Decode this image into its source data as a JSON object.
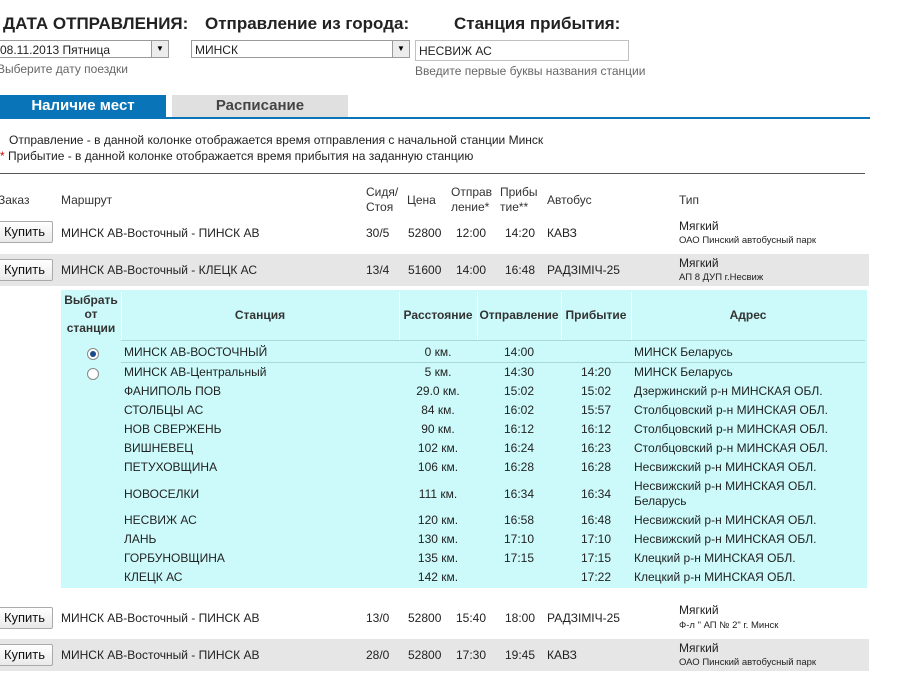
{
  "form": {
    "date_label": "ДАТА ОТПРАВЛЕНИЯ:",
    "date_value": "08.11.2013 Пятница",
    "date_hint": "Выберите дату поездки",
    "from_label": "Отправление из города:",
    "from_value": "МИНСК",
    "to_label": "Станция прибытия:",
    "to_value": "НЕСВИЖ АС",
    "to_hint": "Введите первые буквы названия станции"
  },
  "tabs": [
    {
      "label": "Наличие мест"
    },
    {
      "label": "Расписание"
    }
  ],
  "notes": {
    "line1": "Отправление - в данной колонке отображается время отправления с начальной станции Минск",
    "asterisk": "*",
    "line2": " Прибытие - в данной колонке отображается время прибытия на заданную станцию"
  },
  "table": {
    "headers": {
      "order": "Заказ",
      "route": "Маршрут",
      "seats_1": "Сидя/",
      "seats_2": "Стоя",
      "price": "Цена",
      "dep_1": "Отправ",
      "dep_2": "ление*",
      "arr_1": "Прибы",
      "arr_2": "тие**",
      "bus": "Автобус",
      "type": "Тип"
    },
    "buy_label": "Купить",
    "rows": [
      {
        "route": "МИНСК АВ-Восточный - ПИНСК АВ",
        "seats": "30/5",
        "price": "52800",
        "dep": "12:00",
        "arr": "14:20",
        "bus": "КАВЗ",
        "type": "Мягкий",
        "carrier": "ОАО Пинский автобусный парк"
      },
      {
        "route": "МИНСК АВ-Восточный - КЛЕЦК АС",
        "seats": "13/4",
        "price": "51600",
        "dep": "14:00",
        "arr": "16:48",
        "bus": "РАДЗІМІЧ-25",
        "type": "Мягкий",
        "carrier": "АП 8 ДУП г.Несвиж"
      },
      {
        "route": "МИНСК АВ-Восточный - ПИНСК АВ",
        "seats": "13/0",
        "price": "52800",
        "dep": "15:40",
        "arr": "18:00",
        "bus": "РАДЗІМІЧ-25",
        "type": "Мягкий",
        "carrier": "Ф-л \" АП № 2\" г. Минск"
      },
      {
        "route": "МИНСК АВ-Восточный - ПИНСК АВ",
        "seats": "28/0",
        "price": "52800",
        "dep": "17:30",
        "arr": "19:45",
        "bus": "КАВЗ",
        "type": "Мягкий",
        "carrier": "ОАО Пинский автобусный парк"
      }
    ]
  },
  "stops": {
    "headers": {
      "choose_1": "Выбрать",
      "choose_2": "от",
      "choose_3": "станции",
      "station": "Станция",
      "distance": "Расстояние",
      "departure": "Отправление",
      "arrival": "Прибытие",
      "address": "Адрес"
    },
    "rows": [
      {
        "station": "МИНСК АВ-ВОСТОЧНЫЙ",
        "distance": "0 км.",
        "dep": "14:00",
        "arr": "",
        "address": "МИНСК Беларусь",
        "selected": true
      },
      {
        "station": "МИНСК АВ-Центральный",
        "distance": "5 км.",
        "dep": "14:30",
        "arr": "14:20",
        "address": "МИНСК Беларусь",
        "selected": false
      },
      {
        "station": "ФАНИПОЛЬ ПОВ",
        "distance": "29.0 км.",
        "dep": "15:02",
        "arr": "15:02",
        "address": "Дзержинский р-н МИНСКАЯ ОБЛ."
      },
      {
        "station": "СТОЛБЦЫ АС",
        "distance": "84 км.",
        "dep": "16:02",
        "arr": "15:57",
        "address": "Столбцовский р-н МИНСКАЯ ОБЛ."
      },
      {
        "station": "НОВ СВЕРЖЕНЬ",
        "distance": "90 км.",
        "dep": "16:12",
        "arr": "16:12",
        "address": "Столбцовский р-н МИНСКАЯ ОБЛ."
      },
      {
        "station": "ВИШНЕВЕЦ",
        "distance": "102 км.",
        "dep": "16:24",
        "arr": "16:23",
        "address": "Столбцовский р-н МИНСКАЯ ОБЛ."
      },
      {
        "station": "ПЕТУХОВЩИНА",
        "distance": "106 км.",
        "dep": "16:28",
        "arr": "16:28",
        "address": "Несвижский р-н МИНСКАЯ ОБЛ."
      },
      {
        "station": "НОВОСЕЛКИ",
        "distance": "111 км.",
        "dep": "16:34",
        "arr": "16:34",
        "address": "Несвижский р-н МИНСКАЯ ОБЛ.",
        "address2": "Беларусь"
      },
      {
        "station": "НЕСВИЖ АС",
        "distance": "120 км.",
        "dep": "16:58",
        "arr": "16:48",
        "address": "Несвижский р-н МИНСКАЯ ОБЛ."
      },
      {
        "station": "ЛАНЬ",
        "distance": "130 км.",
        "dep": "17:10",
        "arr": "17:10",
        "address": "Несвижский р-н МИНСКАЯ ОБЛ."
      },
      {
        "station": "ГОРБУНОВЩИНА",
        "distance": "135 км.",
        "dep": "17:15",
        "arr": "17:15",
        "address": "Клецкий р-н МИНСКАЯ ОБЛ."
      },
      {
        "station": "КЛЕЦК АС",
        "distance": "142 км.",
        "dep": "",
        "arr": "17:22",
        "address": "Клецкий р-н МИНСКАЯ ОБЛ."
      }
    ]
  },
  "colors": {
    "accent": "#0a74b9",
    "panel": "#ccfafa",
    "row_gray": "#e6e6e6"
  }
}
